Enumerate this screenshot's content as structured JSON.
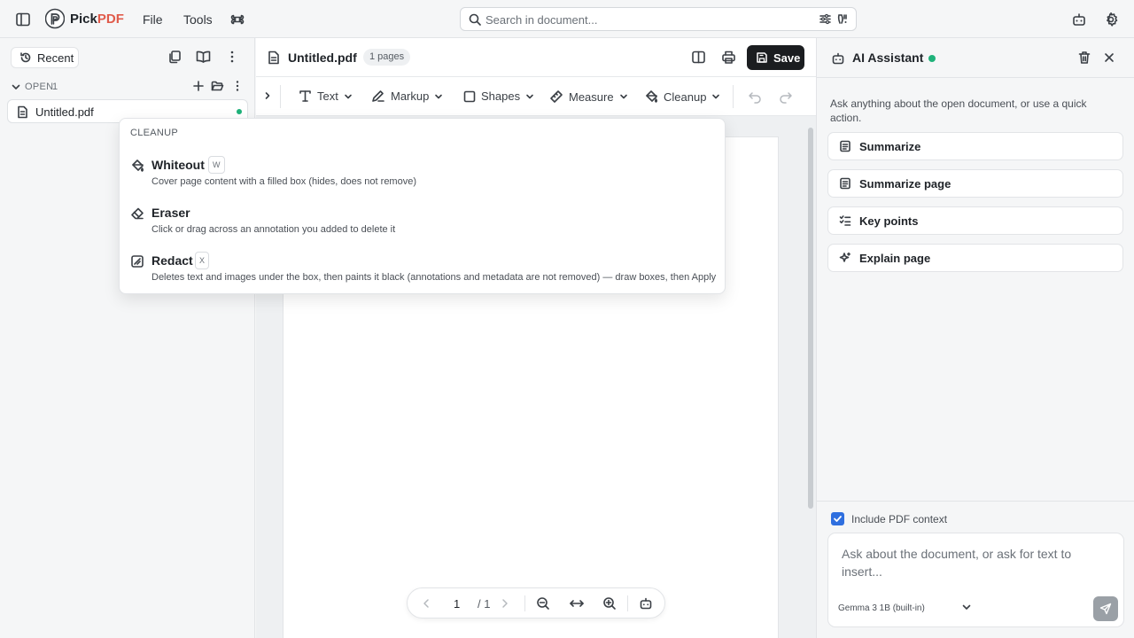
{
  "app": {
    "brand_prefix": "Pick",
    "brand_accent": "PDF",
    "menu": {
      "file": "File",
      "tools": "Tools"
    },
    "search_placeholder": "Search in document...",
    "accent_color": "#e05b4b",
    "status_color": "#1fb27a"
  },
  "sidebar": {
    "recent_label": "Recent",
    "open_label": "OPEN",
    "open_count": "1",
    "files": [
      {
        "name": "Untitled.pdf",
        "modified": true
      }
    ]
  },
  "document": {
    "title": "Untitled.pdf",
    "pages_badge": "1 pages",
    "save_label": "Save",
    "toolbar": {
      "text": "Text",
      "markup": "Markup",
      "shapes": "Shapes",
      "measure": "Measure",
      "cleanup": "Cleanup"
    },
    "pager": {
      "current": "1",
      "total": "/ 1"
    }
  },
  "cleanup_menu": {
    "header": "CLEANUP",
    "items": [
      {
        "title": "Whiteout",
        "key": "W",
        "desc": "Cover page content with a filled box (hides, does not remove)"
      },
      {
        "title": "Eraser",
        "key": "",
        "desc": "Click or drag across an annotation you added to delete it"
      },
      {
        "title": "Redact",
        "key": "X",
        "desc": "Deletes text and images under the box, then paints it black (annotations and metadata are not removed) — draw boxes, then Apply"
      }
    ]
  },
  "assistant": {
    "title": "AI Assistant",
    "intro": "Ask anything about the open document, or use a quick action.",
    "quick_actions": [
      "Summarize",
      "Summarize page",
      "Key points",
      "Explain page"
    ],
    "include_context_label": "Include PDF context",
    "include_context_checked": true,
    "composer_placeholder": "Ask about the document, or ask for text to insert...",
    "model": "Gemma 3 1B (built-in)"
  }
}
